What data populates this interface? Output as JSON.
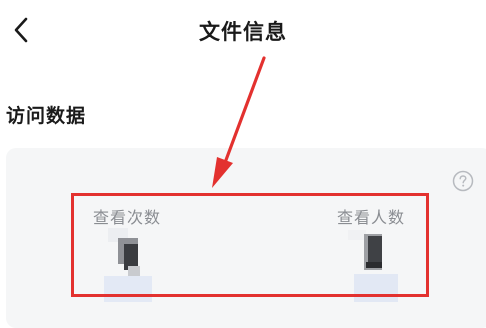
{
  "header": {
    "title": "文件信息",
    "back_icon": "chevron-left-icon"
  },
  "section": {
    "title": "访问数据"
  },
  "stats": {
    "views_label": "查看次数",
    "visitors_label": "查看人数",
    "help_icon": "question-circle-icon"
  },
  "colors": {
    "annotation": "#e3312f",
    "card_background": "#f5f6f7",
    "label_text": "#8a8d92"
  }
}
